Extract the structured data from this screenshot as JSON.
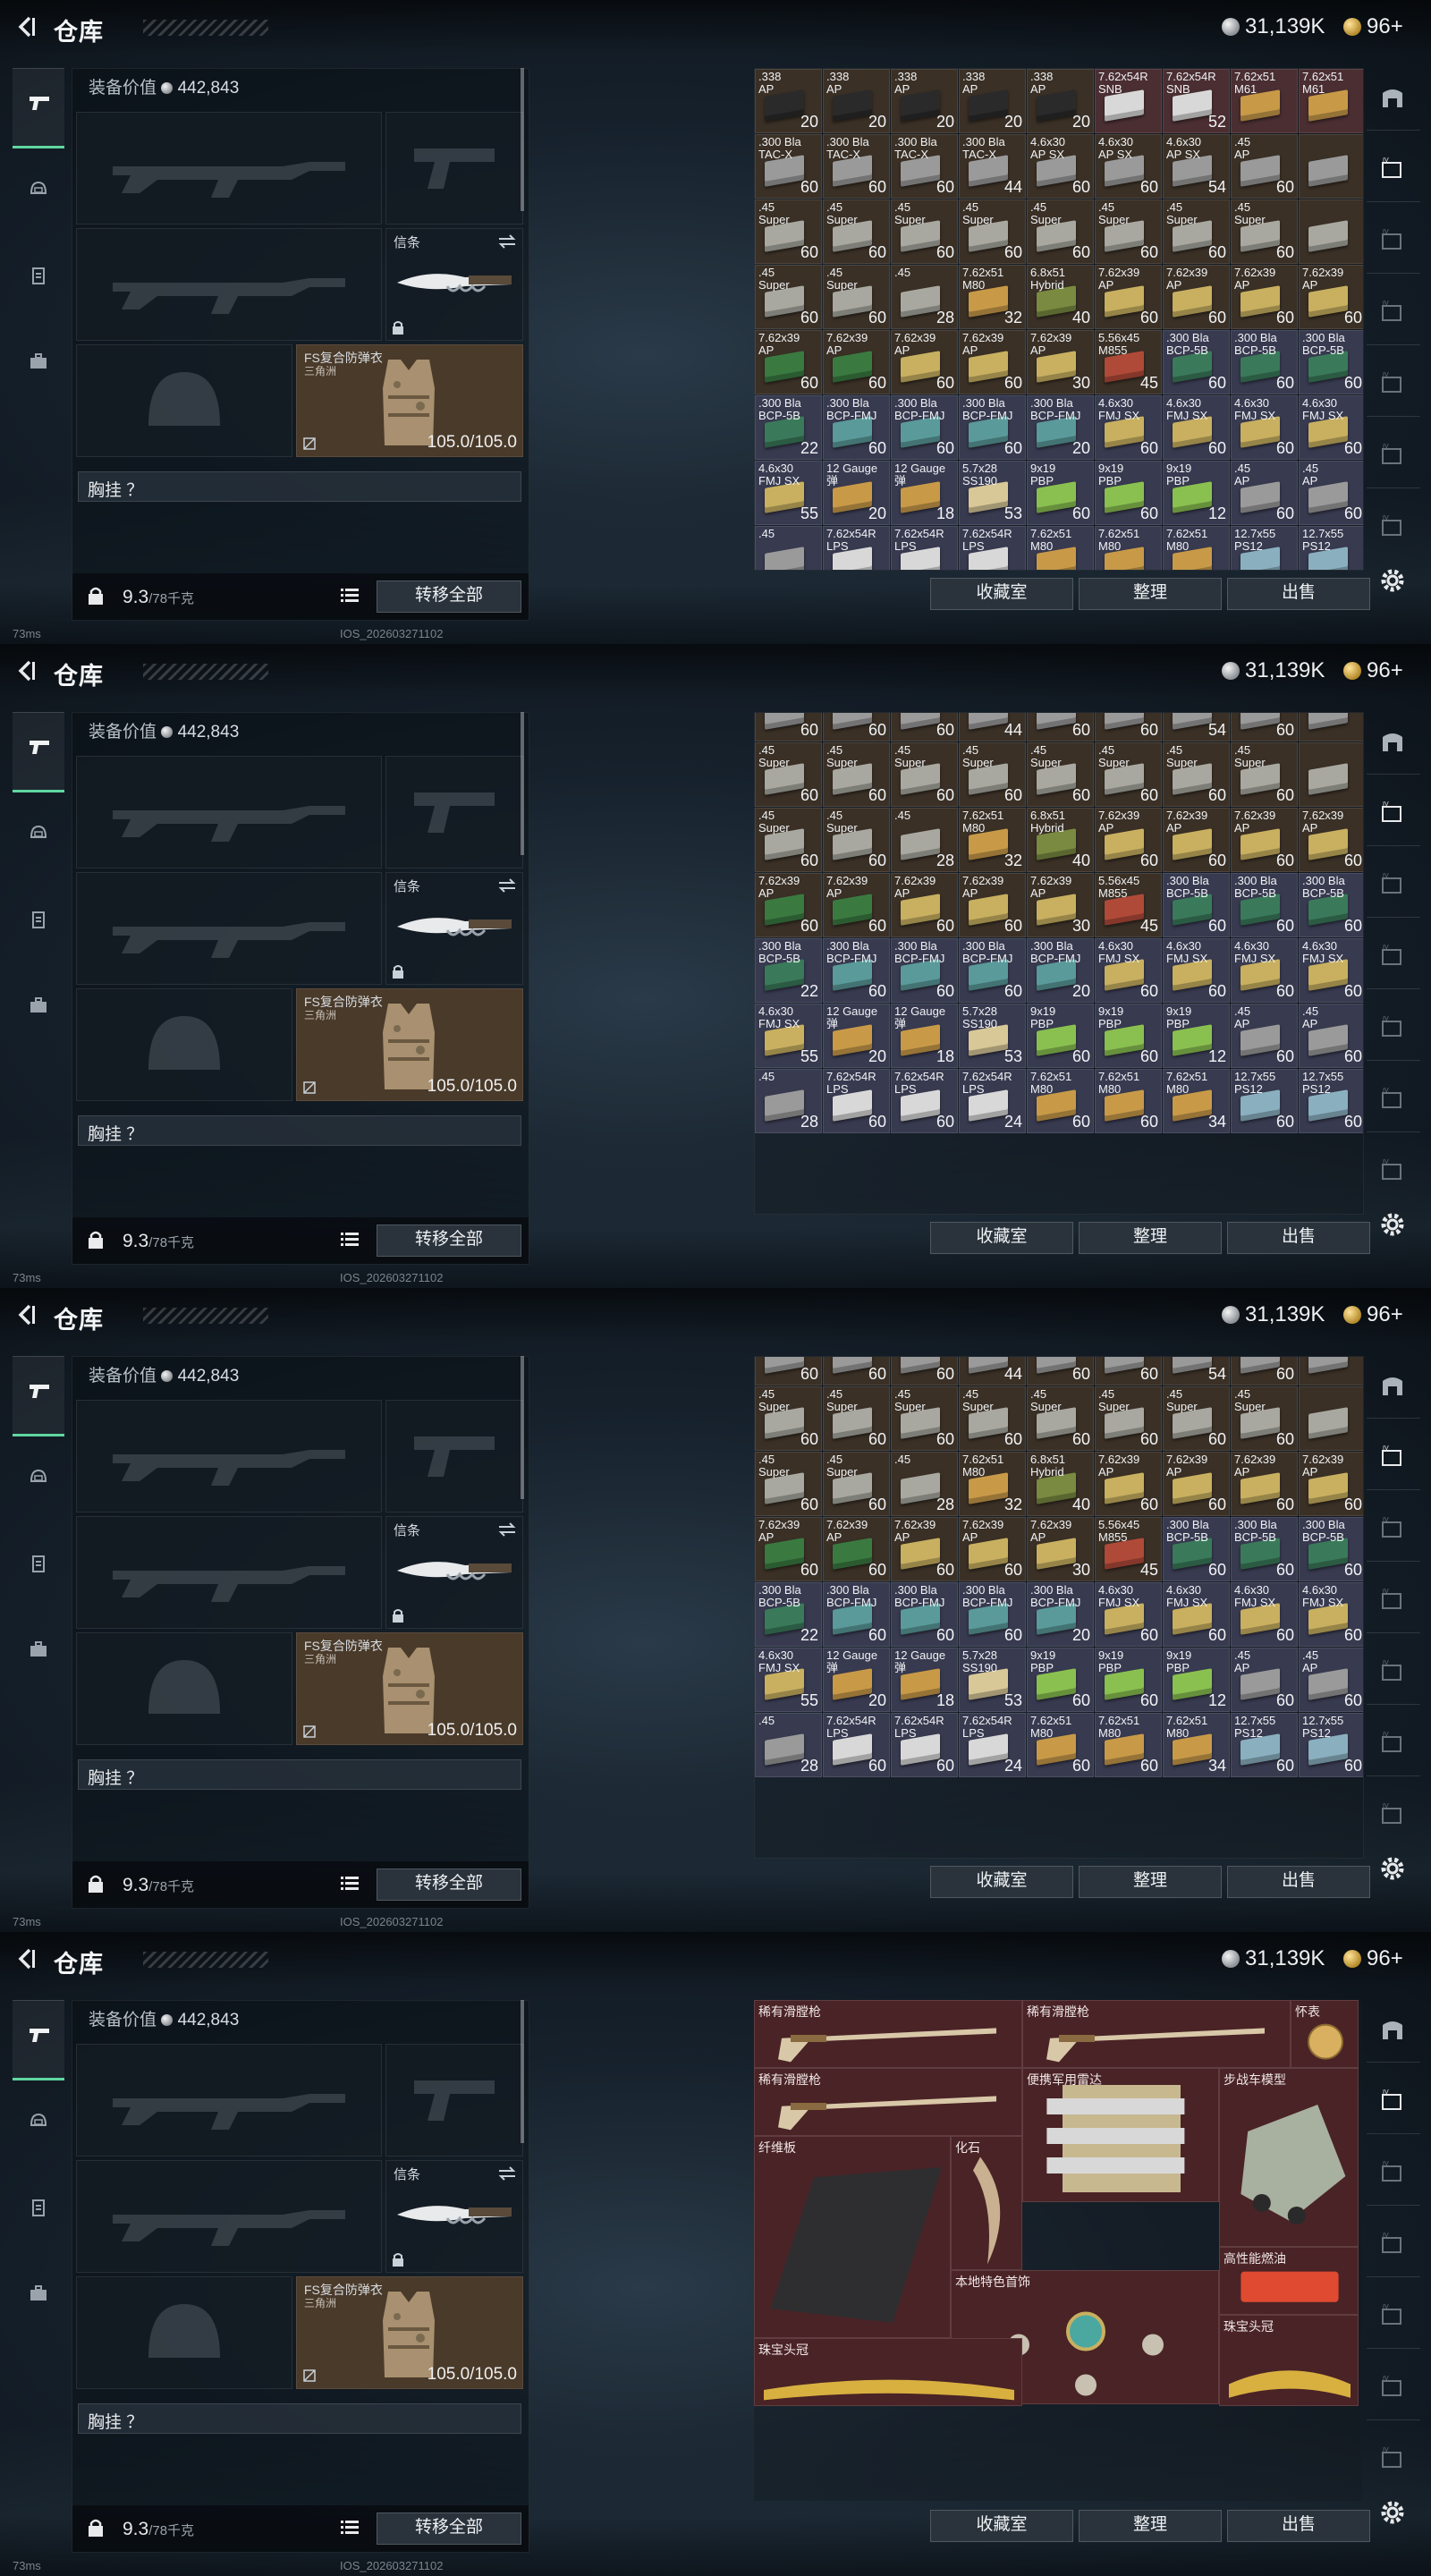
{
  "header": {
    "title": "仓库",
    "silver": "31,139K",
    "gold": "96+"
  },
  "loadout": {
    "equip_value_label": "装备价值",
    "equip_value": "442,843",
    "knife_label": "信条",
    "armor_label": "FS复合防弹衣",
    "armor_sub": "三角洲",
    "armor_durability": "105.0/105.0",
    "chest_label": "胸挂 ？",
    "weight": "9.3",
    "weight_max": "/78千克",
    "transfer_label": "转移全部"
  },
  "actions": {
    "collection": "收藏室",
    "sort": "整理",
    "sell": "出售"
  },
  "status": {
    "latency": "73ms",
    "build": "IOS_202603271102"
  },
  "colors": {
    "accent": "#5fd6a0",
    "collection_bg": "#4a2326"
  },
  "storage_pages": [
    [
      {
        "n": ".338\nAP",
        "q": "20",
        "c": "#3a3026",
        "b": "#2a2a2a"
      },
      {
        "n": ".338\nAP",
        "q": "20",
        "c": "#3a3026",
        "b": "#2a2a2a"
      },
      {
        "n": ".338\nAP",
        "q": "20",
        "c": "#3a3026",
        "b": "#2a2a2a"
      },
      {
        "n": ".338\nAP",
        "q": "20",
        "c": "#3a3026",
        "b": "#2a2a2a"
      },
      {
        "n": ".338\nAP",
        "q": "20",
        "c": "#3a3026",
        "b": "#2a2a2a"
      },
      {
        "n": "7.62x54R\nSNB",
        "q": "",
        "c": "#4a2e32",
        "b": "#d8d8d8"
      },
      {
        "n": "7.62x54R\nSNB",
        "q": "52",
        "c": "#4a2e32",
        "b": "#d8d8d8"
      },
      {
        "n": "7.62x51\nM61",
        "q": "",
        "c": "#4a2e32",
        "b": "#c89a48"
      },
      {
        "n": "7.62x51\nM61",
        "q": "",
        "c": "#4a2e32",
        "b": "#c89a48"
      },
      {
        "n": ".300 Bla\nTAC-X",
        "q": "60",
        "c": "#3a3026",
        "b": "#9a9a9a"
      },
      {
        "n": ".300 Bla\nTAC-X",
        "q": "60",
        "c": "#3a3026",
        "b": "#9a9a9a"
      },
      {
        "n": ".300 Bla\nTAC-X",
        "q": "60",
        "c": "#3a3026",
        "b": "#9a9a9a"
      },
      {
        "n": ".300 Bla\nTAC-X",
        "q": "44",
        "c": "#3a3026",
        "b": "#9a9a9a"
      },
      {
        "n": "4.6x30\nAP SX",
        "q": "60",
        "c": "#3a3026",
        "b": "#9a9a9a"
      },
      {
        "n": "4.6x30\nAP SX",
        "q": "60",
        "c": "#3a3026",
        "b": "#9a9a9a"
      },
      {
        "n": "4.6x30\nAP SX",
        "q": "54",
        "c": "#3a3026",
        "b": "#9a9a9a"
      },
      {
        "n": ".45\nAP",
        "q": "60",
        "c": "#3a3026",
        "b": "#9a9a9a"
      },
      {
        "n": "",
        "q": "",
        "c": "#3a3026",
        "b": "#9a9a9a"
      },
      {
        "n": ".45\nSuper",
        "q": "60",
        "c": "#3a3026",
        "b": "#a8a8a0"
      },
      {
        "n": ".45\nSuper",
        "q": "60",
        "c": "#3a3026",
        "b": "#a8a8a0"
      },
      {
        "n": ".45\nSuper",
        "q": "60",
        "c": "#3a3026",
        "b": "#a8a8a0"
      },
      {
        "n": ".45\nSuper",
        "q": "60",
        "c": "#3a3026",
        "b": "#a8a8a0"
      },
      {
        "n": ".45\nSuper",
        "q": "60",
        "c": "#3a3026",
        "b": "#a8a8a0"
      },
      {
        "n": ".45\nSuper",
        "q": "60",
        "c": "#3a3026",
        "b": "#a8a8a0"
      },
      {
        "n": ".45\nSuper",
        "q": "60",
        "c": "#3a3026",
        "b": "#a8a8a0"
      },
      {
        "n": ".45\nSuper",
        "q": "60",
        "c": "#3a3026",
        "b": "#a8a8a0"
      },
      {
        "n": "",
        "q": "",
        "c": "#3a3026",
        "b": "#a8a8a0"
      },
      {
        "n": ".45\nSuper",
        "q": "60",
        "c": "#3a3026",
        "b": "#a8a8a0"
      },
      {
        "n": ".45\nSuper",
        "q": "60",
        "c": "#3a3026",
        "b": "#a8a8a0"
      },
      {
        "n": ".45",
        "q": "28",
        "c": "#3a3026",
        "b": "#a8a8a0"
      },
      {
        "n": "7.62x51\nM80",
        "q": "32",
        "c": "#3a3026",
        "b": "#c89a48"
      },
      {
        "n": "6.8x51\nHybrid",
        "q": "40",
        "c": "#3a3026",
        "b": "#7a8a40"
      },
      {
        "n": "7.62x39\nAP",
        "q": "60",
        "c": "#3a3026",
        "b": "#c8b060"
      },
      {
        "n": "7.62x39\nAP",
        "q": "60",
        "c": "#3a3026",
        "b": "#c8b060"
      },
      {
        "n": "7.62x39\nAP",
        "q": "60",
        "c": "#3a3026",
        "b": "#c8b060"
      },
      {
        "n": "7.62x39\nAP",
        "q": "60",
        "c": "#3a3026",
        "b": "#c8b060"
      },
      {
        "n": "7.62x39\nAP",
        "q": "60",
        "c": "#3a3026",
        "b": "#3a7a40"
      },
      {
        "n": "7.62x39\nAP",
        "q": "60",
        "c": "#3a3026",
        "b": "#3a7a40"
      },
      {
        "n": "7.62x39\nAP",
        "q": "60",
        "c": "#3a3026",
        "b": "#c8b060"
      },
      {
        "n": "7.62x39\nAP",
        "q": "60",
        "c": "#3a3026",
        "b": "#c8b060"
      },
      {
        "n": "7.62x39\nAP",
        "q": "30",
        "c": "#3a3026",
        "b": "#c8b060"
      },
      {
        "n": "5.56x45\nM855",
        "q": "45",
        "c": "#3a3026",
        "b": "#b04a38"
      },
      {
        "n": ".300 Bla\nBCP-5B",
        "q": "60",
        "c": "#383a50",
        "b": "#3a7a5a"
      },
      {
        "n": ".300 Bla\nBCP-5B",
        "q": "60",
        "c": "#383a50",
        "b": "#3a7a5a"
      },
      {
        "n": ".300 Bla\nBCP-5B",
        "q": "60",
        "c": "#383a50",
        "b": "#3a7a5a"
      },
      {
        "n": ".300 Bla\nBCP-5B",
        "q": "22",
        "c": "#383a50",
        "b": "#3a7a5a"
      },
      {
        "n": ".300 Bla\nBCP-FMJ",
        "q": "60",
        "c": "#383a50",
        "b": "#5a9a9a"
      },
      {
        "n": ".300 Bla\nBCP-FMJ",
        "q": "60",
        "c": "#383a50",
        "b": "#5a9a9a"
      },
      {
        "n": ".300 Bla\nBCP-FMJ",
        "q": "60",
        "c": "#383a50",
        "b": "#5a9a9a"
      },
      {
        "n": ".300 Bla\nBCP-FMJ",
        "q": "20",
        "c": "#383a50",
        "b": "#5a9a9a"
      },
      {
        "n": "4.6x30\nFMJ SX",
        "q": "60",
        "c": "#383a50",
        "b": "#c8b060"
      },
      {
        "n": "4.6x30\nFMJ SX",
        "q": "60",
        "c": "#383a50",
        "b": "#c8b060"
      },
      {
        "n": "4.6x30\nFMJ SX",
        "q": "60",
        "c": "#383a50",
        "b": "#c8b060"
      },
      {
        "n": "4.6x30\nFMJ SX",
        "q": "60",
        "c": "#383a50",
        "b": "#c8b060"
      },
      {
        "n": "4.6x30\nFMJ SX",
        "q": "55",
        "c": "#383a50",
        "b": "#c8b060"
      },
      {
        "n": "12 Gauge\n弹",
        "q": "20",
        "c": "#383a50",
        "b": "#c89a48"
      },
      {
        "n": "12 Gauge\n弹",
        "q": "18",
        "c": "#383a50",
        "b": "#c89a48"
      },
      {
        "n": "5.7x28\nSS190",
        "q": "53",
        "c": "#383a50",
        "b": "#d8c898"
      },
      {
        "n": "9x19\nPBP",
        "q": "60",
        "c": "#383a50",
        "b": "#8ac050"
      },
      {
        "n": "9x19\nPBP",
        "q": "60",
        "c": "#383a50",
        "b": "#8ac050"
      },
      {
        "n": "9x19\nPBP",
        "q": "12",
        "c": "#383a50",
        "b": "#8ac050"
      },
      {
        "n": ".45\nAP",
        "q": "60",
        "c": "#383a50",
        "b": "#9a9a9a"
      },
      {
        "n": ".45\nAP",
        "q": "60",
        "c": "#383a50",
        "b": "#9a9a9a"
      },
      {
        "n": ".45",
        "q": "",
        "c": "#383a50",
        "b": "#9a9a9a"
      },
      {
        "n": "7.62x54R\nLPS",
        "q": "",
        "c": "#383a50",
        "b": "#d8d8d8"
      },
      {
        "n": "7.62x54R\nLPS",
        "q": "",
        "c": "#383a50",
        "b": "#d8d8d8"
      },
      {
        "n": "7.62x54R\nLPS",
        "q": "",
        "c": "#383a50",
        "b": "#d8d8d8"
      },
      {
        "n": "7.62x51\nM80",
        "q": "",
        "c": "#383a50",
        "b": "#c89a48"
      },
      {
        "n": "7.62x51\nM80",
        "q": "",
        "c": "#383a50",
        "b": "#c89a48"
      },
      {
        "n": "7.62x51\nM80",
        "q": "",
        "c": "#383a50",
        "b": "#c89a48"
      },
      {
        "n": "12.7x55\nPS12",
        "q": "",
        "c": "#383a50",
        "b": "#8ab0c0"
      },
      {
        "n": "12.7x55\nPS12",
        "q": "",
        "c": "#383a50",
        "b": "#8ab0c0"
      }
    ],
    [
      {
        "n": "",
        "q": "60",
        "c": "#3a3026",
        "b": "#9a9a9a"
      },
      {
        "n": "",
        "q": "60",
        "c": "#3a3026",
        "b": "#9a9a9a"
      },
      {
        "n": "",
        "q": "60",
        "c": "#3a3026",
        "b": "#9a9a9a"
      },
      {
        "n": "",
        "q": "44",
        "c": "#3a3026",
        "b": "#9a9a9a"
      },
      {
        "n": "",
        "q": "60",
        "c": "#3a3026",
        "b": "#9a9a9a"
      },
      {
        "n": "",
        "q": "60",
        "c": "#3a3026",
        "b": "#9a9a9a"
      },
      {
        "n": "",
        "q": "54",
        "c": "#3a3026",
        "b": "#9a9a9a"
      },
      {
        "n": "",
        "q": "60",
        "c": "#3a3026",
        "b": "#9a9a9a"
      },
      {
        "n": "",
        "q": "",
        "c": "#3a3026",
        "b": "#9a9a9a"
      },
      {
        "n": ".45\nSuper",
        "q": "60",
        "c": "#3a3026",
        "b": "#a8a8a0"
      },
      {
        "n": ".45\nSuper",
        "q": "60",
        "c": "#3a3026",
        "b": "#a8a8a0"
      },
      {
        "n": ".45\nSuper",
        "q": "60",
        "c": "#3a3026",
        "b": "#a8a8a0"
      },
      {
        "n": ".45\nSuper",
        "q": "60",
        "c": "#3a3026",
        "b": "#a8a8a0"
      },
      {
        "n": ".45\nSuper",
        "q": "60",
        "c": "#3a3026",
        "b": "#a8a8a0"
      },
      {
        "n": ".45\nSuper",
        "q": "60",
        "c": "#3a3026",
        "b": "#a8a8a0"
      },
      {
        "n": ".45\nSuper",
        "q": "60",
        "c": "#3a3026",
        "b": "#a8a8a0"
      },
      {
        "n": ".45\nSuper",
        "q": "60",
        "c": "#3a3026",
        "b": "#a8a8a0"
      },
      {
        "n": "",
        "q": "",
        "c": "#3a3026",
        "b": "#a8a8a0"
      },
      {
        "n": ".45\nSuper",
        "q": "60",
        "c": "#3a3026",
        "b": "#a8a8a0"
      },
      {
        "n": ".45\nSuper",
        "q": "60",
        "c": "#3a3026",
        "b": "#a8a8a0"
      },
      {
        "n": ".45",
        "q": "28",
        "c": "#3a3026",
        "b": "#a8a8a0"
      },
      {
        "n": "7.62x51\nM80",
        "q": "32",
        "c": "#3a3026",
        "b": "#c89a48"
      },
      {
        "n": "6.8x51\nHybrid",
        "q": "40",
        "c": "#3a3026",
        "b": "#7a8a40"
      },
      {
        "n": "7.62x39\nAP",
        "q": "60",
        "c": "#3a3026",
        "b": "#c8b060"
      },
      {
        "n": "7.62x39\nAP",
        "q": "60",
        "c": "#3a3026",
        "b": "#c8b060"
      },
      {
        "n": "7.62x39\nAP",
        "q": "60",
        "c": "#3a3026",
        "b": "#c8b060"
      },
      {
        "n": "7.62x39\nAP",
        "q": "60",
        "c": "#3a3026",
        "b": "#c8b060"
      },
      {
        "n": "7.62x39\nAP",
        "q": "60",
        "c": "#3a3026",
        "b": "#3a7a40"
      },
      {
        "n": "7.62x39\nAP",
        "q": "60",
        "c": "#3a3026",
        "b": "#3a7a40"
      },
      {
        "n": "7.62x39\nAP",
        "q": "60",
        "c": "#3a3026",
        "b": "#c8b060"
      },
      {
        "n": "7.62x39\nAP",
        "q": "60",
        "c": "#3a3026",
        "b": "#c8b060"
      },
      {
        "n": "7.62x39\nAP",
        "q": "30",
        "c": "#3a3026",
        "b": "#c8b060"
      },
      {
        "n": "5.56x45\nM855",
        "q": "45",
        "c": "#3a3026",
        "b": "#b04a38"
      },
      {
        "n": ".300 Bla\nBCP-5B",
        "q": "60",
        "c": "#383a50",
        "b": "#3a7a5a"
      },
      {
        "n": ".300 Bla\nBCP-5B",
        "q": "60",
        "c": "#383a50",
        "b": "#3a7a5a"
      },
      {
        "n": ".300 Bla\nBCP-5B",
        "q": "60",
        "c": "#383a50",
        "b": "#3a7a5a"
      },
      {
        "n": ".300 Bla\nBCP-5B",
        "q": "22",
        "c": "#383a50",
        "b": "#3a7a5a"
      },
      {
        "n": ".300 Bla\nBCP-FMJ",
        "q": "60",
        "c": "#383a50",
        "b": "#5a9a9a"
      },
      {
        "n": ".300 Bla\nBCP-FMJ",
        "q": "60",
        "c": "#383a50",
        "b": "#5a9a9a"
      },
      {
        "n": ".300 Bla\nBCP-FMJ",
        "q": "60",
        "c": "#383a50",
        "b": "#5a9a9a"
      },
      {
        "n": ".300 Bla\nBCP-FMJ",
        "q": "20",
        "c": "#383a50",
        "b": "#5a9a9a"
      },
      {
        "n": "4.6x30\nFMJ SX",
        "q": "60",
        "c": "#383a50",
        "b": "#c8b060"
      },
      {
        "n": "4.6x30\nFMJ SX",
        "q": "60",
        "c": "#383a50",
        "b": "#c8b060"
      },
      {
        "n": "4.6x30\nFMJ SX",
        "q": "60",
        "c": "#383a50",
        "b": "#c8b060"
      },
      {
        "n": "4.6x30\nFMJ SX",
        "q": "60",
        "c": "#383a50",
        "b": "#c8b060"
      },
      {
        "n": "4.6x30\nFMJ SX",
        "q": "55",
        "c": "#383a50",
        "b": "#c8b060"
      },
      {
        "n": "12 Gauge\n弹",
        "q": "20",
        "c": "#383a50",
        "b": "#c89a48"
      },
      {
        "n": "12 Gauge\n弹",
        "q": "18",
        "c": "#383a50",
        "b": "#c89a48"
      },
      {
        "n": "5.7x28\nSS190",
        "q": "53",
        "c": "#383a50",
        "b": "#d8c898"
      },
      {
        "n": "9x19\nPBP",
        "q": "60",
        "c": "#383a50",
        "b": "#8ac050"
      },
      {
        "n": "9x19\nPBP",
        "q": "60",
        "c": "#383a50",
        "b": "#8ac050"
      },
      {
        "n": "9x19\nPBP",
        "q": "12",
        "c": "#383a50",
        "b": "#8ac050"
      },
      {
        "n": ".45\nAP",
        "q": "60",
        "c": "#383a50",
        "b": "#9a9a9a"
      },
      {
        "n": ".45\nAP",
        "q": "60",
        "c": "#383a50",
        "b": "#9a9a9a"
      },
      {
        "n": ".45",
        "q": "28",
        "c": "#383a50",
        "b": "#9a9a9a"
      },
      {
        "n": "7.62x54R\nLPS",
        "q": "60",
        "c": "#383a50",
        "b": "#d8d8d8"
      },
      {
        "n": "7.62x54R\nLPS",
        "q": "60",
        "c": "#383a50",
        "b": "#d8d8d8"
      },
      {
        "n": "7.62x54R\nLPS",
        "q": "24",
        "c": "#383a50",
        "b": "#d8d8d8"
      },
      {
        "n": "7.62x51\nM80",
        "q": "60",
        "c": "#383a50",
        "b": "#c89a48"
      },
      {
        "n": "7.62x51\nM80",
        "q": "60",
        "c": "#383a50",
        "b": "#c89a48"
      },
      {
        "n": "7.62x51\nM80",
        "q": "34",
        "c": "#383a50",
        "b": "#c89a48"
      },
      {
        "n": "12.7x55\nPS12",
        "q": "60",
        "c": "#383a50",
        "b": "#8ab0c0"
      },
      {
        "n": "12.7x55\nPS12",
        "q": "60",
        "c": "#383a50",
        "b": "#8ab0c0"
      }
    ]
  ],
  "collection_items": [
    {
      "label": "稀有滑膛枪"
    },
    {
      "label": "稀有滑膛枪"
    },
    {
      "label": "怀表"
    },
    {
      "label": "稀有滑膛枪"
    },
    {
      "label": "便携军用雷达"
    },
    {
      "label": "步战车模型"
    },
    {
      "label": "纤维板"
    },
    {
      "label": "化石"
    },
    {
      "label": "本地特色首饰"
    },
    {
      "label": "高性能燃油"
    },
    {
      "label": "珠宝头冠"
    },
    {
      "label": "珠宝头冠"
    }
  ]
}
